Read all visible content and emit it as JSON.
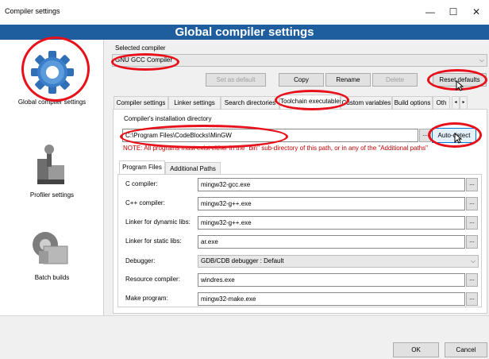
{
  "window": {
    "title": "Compiler settings",
    "min": "—",
    "max": "☐",
    "close": "✕"
  },
  "header": {
    "title": "Global compiler settings"
  },
  "nav": [
    {
      "label": "Global compiler settings",
      "icon": "gear-icon"
    },
    {
      "label": "Profiler settings",
      "icon": "profiler-icon"
    },
    {
      "label": "Batch builds",
      "icon": "batch-builds-icon"
    }
  ],
  "selected_compiler": {
    "label": "Selected compiler",
    "value": "GNU GCC Compiler"
  },
  "compiler_buttons": {
    "set_default": "Set as default",
    "copy": "Copy",
    "rename": "Rename",
    "delete": "Delete",
    "reset_defaults": "Reset defaults"
  },
  "tabs": [
    "Compiler settings",
    "Linker settings",
    "Search directories",
    "Toolchain executables",
    "Custom variables",
    "Build options",
    "Oth"
  ],
  "install": {
    "label": "Compiler's installation directory",
    "value": "C:\\Program Files\\CodeBlocks\\MinGW",
    "dots": "...",
    "auto_detect": "Auto-detect",
    "note": "NOTE: All programs must exist either in the \"bin\" sub-directory of this path, or in any of the \"Additional paths\""
  },
  "subtabs": [
    "Program Files",
    "Additional Paths"
  ],
  "programs": [
    {
      "label": "C compiler:",
      "value": "mingw32-gcc.exe"
    },
    {
      "label": "C++ compiler:",
      "value": "mingw32-g++.exe"
    },
    {
      "label": "Linker for dynamic libs:",
      "value": "mingw32-g++.exe"
    },
    {
      "label": "Linker for static libs:",
      "value": "ar.exe"
    },
    {
      "label": "Debugger:",
      "value": "GDB/CDB debugger : Default"
    },
    {
      "label": "Resource compiler:",
      "value": "windres.exe"
    },
    {
      "label": "Make program:",
      "value": "mingw32-make.exe"
    }
  ],
  "dialog": {
    "ok": "OK",
    "cancel": "Cancel"
  },
  "colors": {
    "header": "#1f5e9e",
    "highlight": "#e8101a",
    "note": "#c00000"
  }
}
